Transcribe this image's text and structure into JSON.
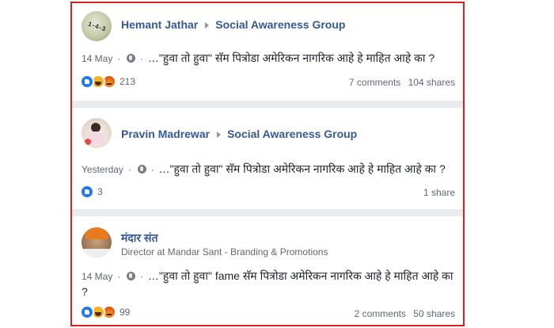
{
  "posts": [
    {
      "author": "Hemant Jathar",
      "group": "Social Awareness Group",
      "avatar_mark": "1-4-3",
      "date": "14 May",
      "text": "…\"हुवा तो हुवा\" सॅम पित्रोडा अमेरिकन नागरिक आहे हे माहित आहे का ?",
      "reactions": [
        "like-icon",
        "haha-icon",
        "angry-icon"
      ],
      "reaction_count": "213",
      "comments": "7 comments",
      "shares": "104 shares"
    },
    {
      "author": "Pravin Madrewar",
      "group": "Social Awareness Group",
      "date": "Yesterday",
      "text": "…\"हुवा तो हुवा\" सॅम पित्रोडा अमेरिकन नागरिक आहे हे माहित आहे का ?",
      "reactions": [
        "like-icon"
      ],
      "reaction_count": "3",
      "shares": "1 share"
    },
    {
      "author": "मंदार संत",
      "subtitle": "Director at Mandar Sant - Branding & Promotions",
      "date": "14 May",
      "text": "…\"हुवा तो हुवा\" fame सॅम पित्रोडा अमेरिकन नागरिक आहे हे माहित आहे का ?",
      "reactions": [
        "like-icon",
        "haha-icon",
        "angry-icon"
      ],
      "reaction_count": "99",
      "comments": "2 comments",
      "shares": "50 shares"
    }
  ],
  "separator": "·",
  "colors": {
    "link": "#365899",
    "frame": "#e0201c",
    "feed_bg": "#e9ebee",
    "like": "#2078f4"
  }
}
